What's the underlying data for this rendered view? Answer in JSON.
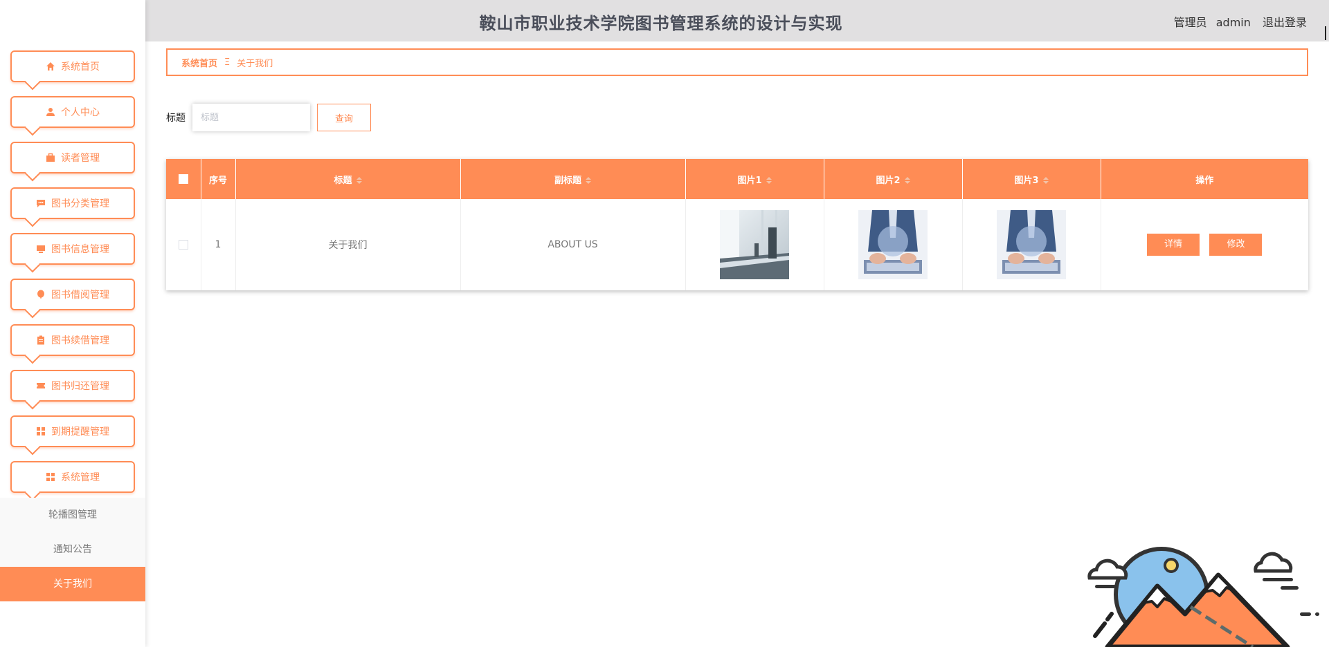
{
  "header": {
    "title": "鞍山市职业技术学院图书管理系统的设计与实现",
    "role": "管理员",
    "username": "admin",
    "logout": "退出登录"
  },
  "sidebar": {
    "items": [
      {
        "label": "系统首页",
        "icon": "home-icon"
      },
      {
        "label": "个人中心",
        "icon": "user-icon"
      },
      {
        "label": "读者管理",
        "icon": "briefcase-icon"
      },
      {
        "label": "图书分类管理",
        "icon": "chat-icon"
      },
      {
        "label": "图书信息管理",
        "icon": "monitor-icon"
      },
      {
        "label": "图书借阅管理",
        "icon": "balloon-icon"
      },
      {
        "label": "图书续借管理",
        "icon": "clipboard-icon"
      },
      {
        "label": "图书归还管理",
        "icon": "ticket-icon"
      },
      {
        "label": "到期提醒管理",
        "icon": "grid-icon"
      },
      {
        "label": "系统管理",
        "icon": "grid-icon"
      }
    ],
    "submenu": [
      {
        "label": "轮播图管理"
      },
      {
        "label": "通知公告"
      },
      {
        "label": "关于我们"
      }
    ]
  },
  "breadcrumb": {
    "home": "系统首页",
    "separator": "Ξ",
    "current": "关于我们"
  },
  "search": {
    "label": "标题",
    "placeholder": "标题",
    "button": "查询"
  },
  "table": {
    "columns": [
      "序号",
      "标题",
      "副标题",
      "图片1",
      "图片2",
      "图片3",
      "操作"
    ],
    "rows": [
      {
        "index": "1",
        "title": "关于我们",
        "subtitle": "ABOUT US"
      }
    ],
    "actions": {
      "detail": "详情",
      "edit": "修改"
    }
  },
  "colors": {
    "accent": "#ff8c55",
    "header_bg": "#e1e0e1"
  }
}
